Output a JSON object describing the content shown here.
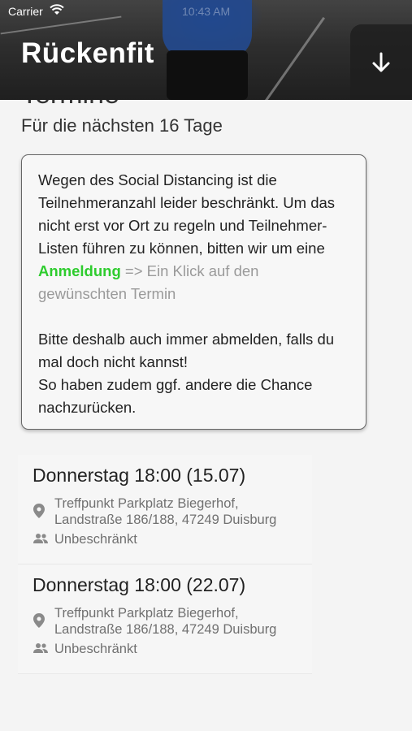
{
  "statusbar": {
    "carrier": "Carrier",
    "time": "10:43 AM"
  },
  "header": {
    "title": "Rückenfit",
    "action_icon": "arrow-down-icon"
  },
  "section": {
    "title": "Termine",
    "subtitle": "Für die nächsten 16 Tage"
  },
  "notice": {
    "part1": "Wegen des Social Distancing ist die Teilnehmeranzahl leider beschränkt. Um das nicht erst vor Ort zu regeln und Teilnehmer-Listen führen zu können, bitten wir um eine ",
    "link": "Anmeldung",
    "part2": " => Ein Klick auf den gewünschten Termin",
    "para2_line1": "Bitte deshalb auch immer abmelden, falls du mal doch nicht kannst!",
    "para2_line2": "So haben zudem ggf. andere die Chance nachzurücken.",
    "link_color": "#2ecc2e"
  },
  "events": [
    {
      "title": "Donnerstag 18:00 (15.07)",
      "location_line1": "Treffpunkt Parkplatz Biegerhof,",
      "location_line2": "Landstraße 186/188, 47249 Duisburg",
      "capacity": "Unbeschränkt"
    },
    {
      "title": "Donnerstag 18:00 (22.07)",
      "location_line1": "Treffpunkt Parkplatz Biegerhof,",
      "location_line2": "Landstraße 186/188, 47249 Duisburg",
      "capacity": "Unbeschränkt"
    }
  ]
}
